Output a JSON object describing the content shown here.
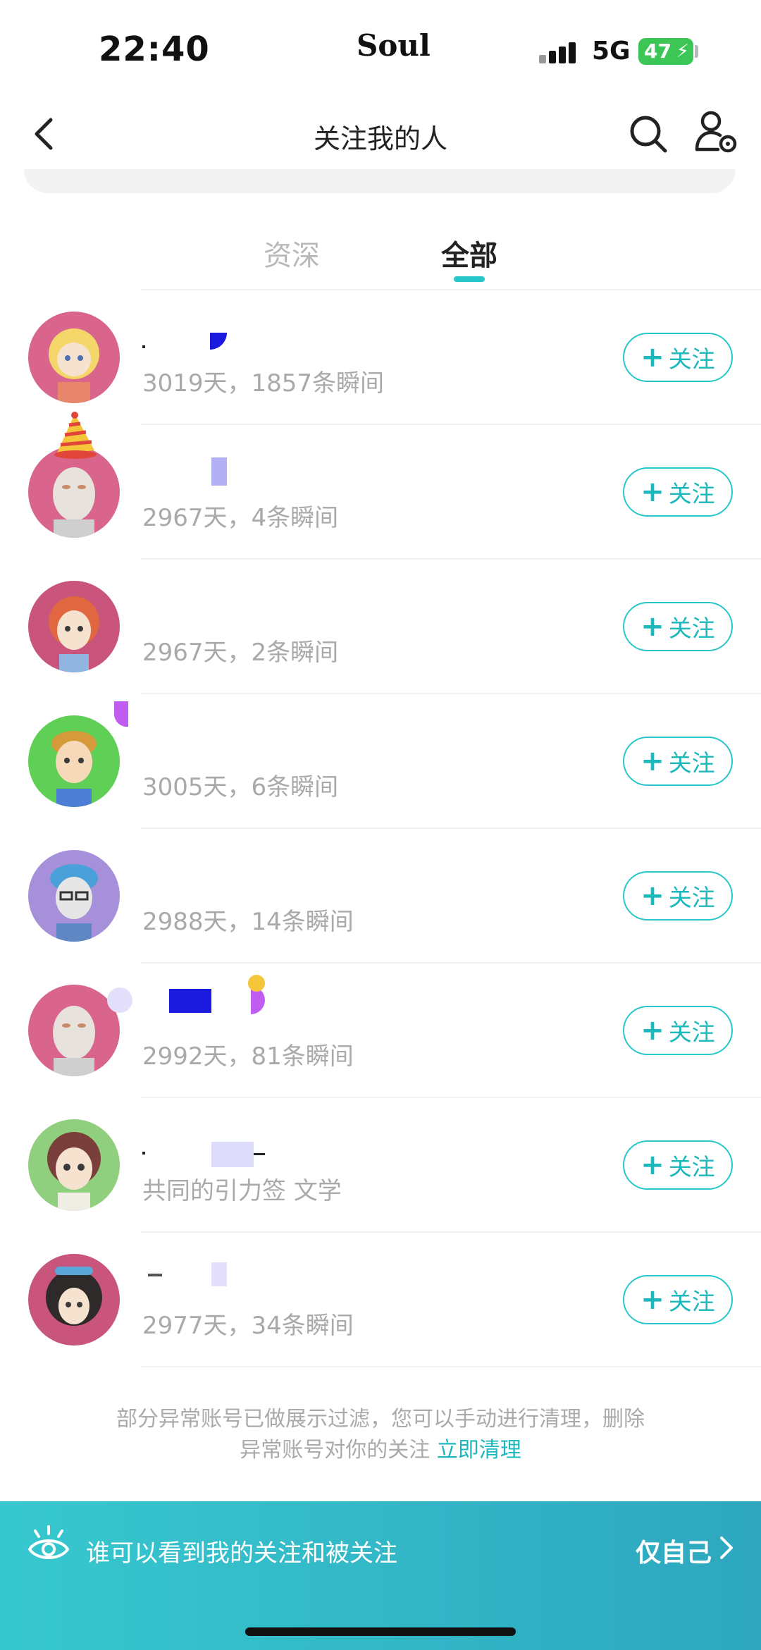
{
  "status_bar": {
    "time": "22:40",
    "carrier_logo": "Soul",
    "network": "5G",
    "battery": "47"
  },
  "nav": {
    "title": "关注我的人",
    "back_icon": "chevron-left-icon",
    "search_icon": "search-icon",
    "settings_icon": "user-settings-icon"
  },
  "tabs": [
    {
      "label": "资深",
      "active": false
    },
    {
      "label": "全部",
      "active": true
    }
  ],
  "colors": {
    "accent": "#27c7c9",
    "muted_text": "#a9a9a9",
    "bar_gradient_start": "#37c8cf",
    "bar_gradient_end": "#2ea7bf"
  },
  "followers": [
    {
      "meta": "3019天，1857条瞬间",
      "button": "关注"
    },
    {
      "meta": "2967天，4条瞬间",
      "button": "关注"
    },
    {
      "meta": "2967天，2条瞬间",
      "button": "关注"
    },
    {
      "meta": "3005天，6条瞬间",
      "button": "关注"
    },
    {
      "meta": "2988天，14条瞬间",
      "button": "关注"
    },
    {
      "meta": "2992天，81条瞬间",
      "button": "关注"
    },
    {
      "meta": "共同的引力签 文学",
      "button": "关注"
    },
    {
      "meta": "2977天，34条瞬间",
      "button": "关注"
    }
  ],
  "note": {
    "line1": "部分异常账号已做展示过滤，您可以手动进行清理，删除",
    "line2": "异常账号对你的关注",
    "link": "立即清理"
  },
  "privacy": {
    "label": "谁可以看到我的关注和被关注",
    "value": "仅自己"
  }
}
